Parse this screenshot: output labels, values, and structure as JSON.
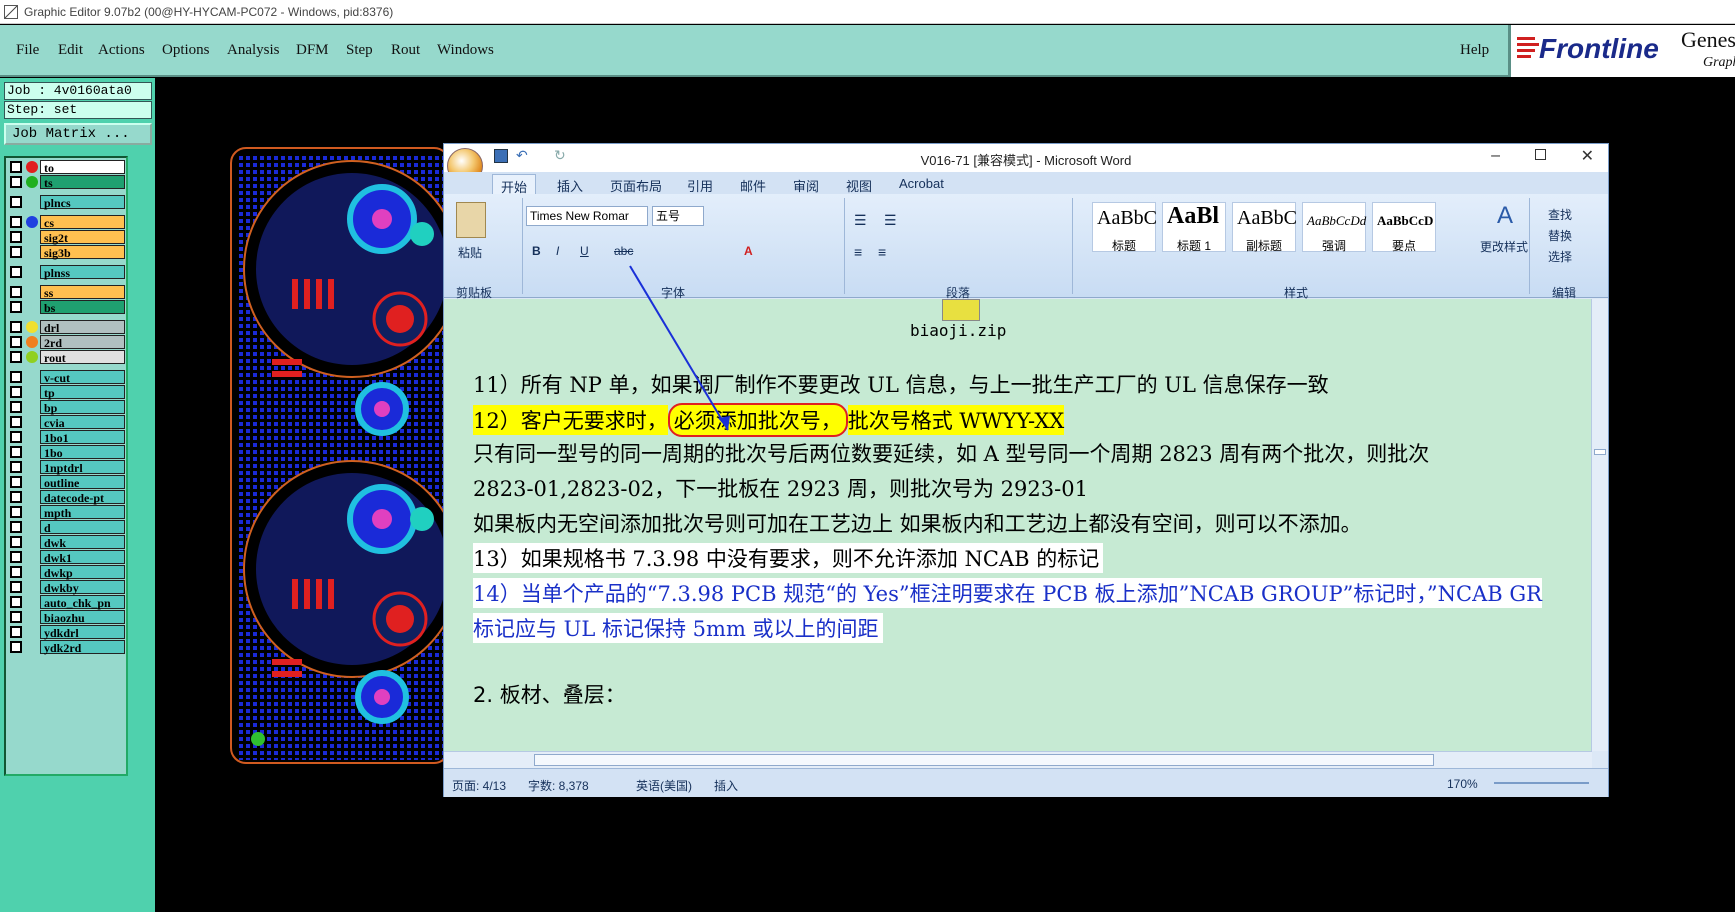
{
  "app": {
    "title": "Graphic Editor 9.07b2 (00@HY-HYCAM-PC072 - Windows, pid:8376)"
  },
  "menu": [
    "File",
    "Edit",
    "Actions",
    "Options",
    "Analysis",
    "DFM",
    "Step",
    "Rout",
    "Windows"
  ],
  "help_label": "Help",
  "logo": {
    "brand": "Frontline",
    "product": "Genes",
    "product2": "Graph"
  },
  "job": {
    "job_label": "Job : 4v0160ata0",
    "step_label": "Step: set",
    "matrix_button": "Job Matrix ..."
  },
  "layers": [
    {
      "name": "to",
      "color": "#ffffff",
      "dot": "#e02020"
    },
    {
      "name": "ts",
      "color": "#1fa070",
      "dot": "#20b020"
    },
    {
      "name": "plncs",
      "color": "#55c8c0",
      "dot": ""
    },
    {
      "name": "cs",
      "color": "#ffc050",
      "dot": "#2040e0"
    },
    {
      "name": "sig2t",
      "color": "#ffc050",
      "dot": ""
    },
    {
      "name": "sig3b",
      "color": "#ffc050",
      "dot": ""
    },
    {
      "name": "plnss",
      "color": "#55c8c0",
      "dot": ""
    },
    {
      "name": "ss",
      "color": "#ffc050",
      "dot": ""
    },
    {
      "name": "bs",
      "color": "#1fa070",
      "dot": ""
    },
    {
      "name": "drl",
      "color": "#b0c0c0",
      "dot": "#f0e030"
    },
    {
      "name": "2rd",
      "color": "#b0c0c0",
      "dot": "#f08020"
    },
    {
      "name": "rout",
      "color": "#e0e0e0",
      "dot": "#90d020"
    },
    {
      "name": "v-cut",
      "color": "#55c8c0",
      "dot": ""
    },
    {
      "name": "tp",
      "color": "#55c8c0",
      "dot": ""
    },
    {
      "name": "bp",
      "color": "#55c8c0",
      "dot": ""
    },
    {
      "name": "cvia",
      "color": "#55c8c0",
      "dot": ""
    },
    {
      "name": "1bo1",
      "color": "#55c8c0",
      "dot": ""
    },
    {
      "name": "1bo",
      "color": "#55c8c0",
      "dot": ""
    },
    {
      "name": "1nptdrl",
      "color": "#55c8c0",
      "dot": ""
    },
    {
      "name": "outline",
      "color": "#55c8c0",
      "dot": ""
    },
    {
      "name": "datecode-pt",
      "color": "#55c8c0",
      "dot": ""
    },
    {
      "name": "mpth",
      "color": "#55c8c0",
      "dot": ""
    },
    {
      "name": "d",
      "color": "#55c8c0",
      "dot": ""
    },
    {
      "name": "dwk",
      "color": "#55c8c0",
      "dot": ""
    },
    {
      "name": "dwk1",
      "color": "#55c8c0",
      "dot": ""
    },
    {
      "name": "dwkp",
      "color": "#55c8c0",
      "dot": ""
    },
    {
      "name": "dwkby",
      "color": "#55c8c0",
      "dot": ""
    },
    {
      "name": "auto_chk_pn",
      "color": "#55c8c0",
      "dot": ""
    },
    {
      "name": "biaozhu",
      "color": "#55c8c0",
      "dot": ""
    },
    {
      "name": "ydkdrl",
      "color": "#55c8c0",
      "dot": ""
    },
    {
      "name": "ydk2rd",
      "color": "#55c8c0",
      "dot": ""
    }
  ],
  "word": {
    "title": "V016-71 [兼容模式] - Microsoft Word",
    "tabs": [
      "开始",
      "插入",
      "页面布局",
      "引用",
      "邮件",
      "审阅",
      "视图",
      "Acrobat"
    ],
    "clipboard": {
      "paste": "粘贴",
      "group": "剪贴板"
    },
    "font": {
      "name": "Times New Romar",
      "size": "五号",
      "group": "字体"
    },
    "paragraph_group": "段落",
    "styles": [
      {
        "sample": "AaBbC",
        "name": "标题"
      },
      {
        "sample": "AaBl",
        "name": "标题 1"
      },
      {
        "sample": "AaBbC",
        "name": "副标题"
      },
      {
        "sample": "AaBbCcDd",
        "name": "强调"
      },
      {
        "sample": "AaBbCcD",
        "name": "要点"
      }
    ],
    "styles_group": "样式",
    "change_styles": "更改样式",
    "edit": {
      "find": "查找",
      "replace": "替换",
      "select": "选择",
      "group": "编辑"
    },
    "doc": {
      "attachment": "biaoji.zip",
      "line11": "11）所有 NP 单，如果调厂制作不要更改 UL 信息，与上一批生产工厂的 UL 信息保存一致",
      "line12a": "12）客户无要求时，",
      "line12b": "必须添加批次号，",
      "line12c": "批次号格式 WWYY-XX",
      "para1": "只有同一型号的同一周期的批次号后两位数要延续，如 A 型号同一个周期 2823 周有两个批次，则批次",
      "para2": "2823-01,2823-02，下一批板在 2923 周，则批次号为 2923-01",
      "para3": "如果板内无空间添加批次号则可加在工艺边上 如果板内和工艺边上都没有空间，则可以不添加。",
      "line13": "13）如果规格书 7.3.98 中没有要求，则不允许添加 NCAB 的标记",
      "line14a": "14）当单个产品的“7.3.98 PCB 规范“的 Yes”框注明要求在 PCB 板上添加”NCAB GROUP”标记时，”NCAB GR",
      "line14b": "标记应与 UL 标记保持 5mm 或以上的间距",
      "heading": "2.   板材、叠层："
    },
    "status": {
      "page": "页面: 4/13",
      "words": "字数: 8,378",
      "lang": "英语(美国)",
      "mode": "插入",
      "zoom": "170%"
    }
  }
}
